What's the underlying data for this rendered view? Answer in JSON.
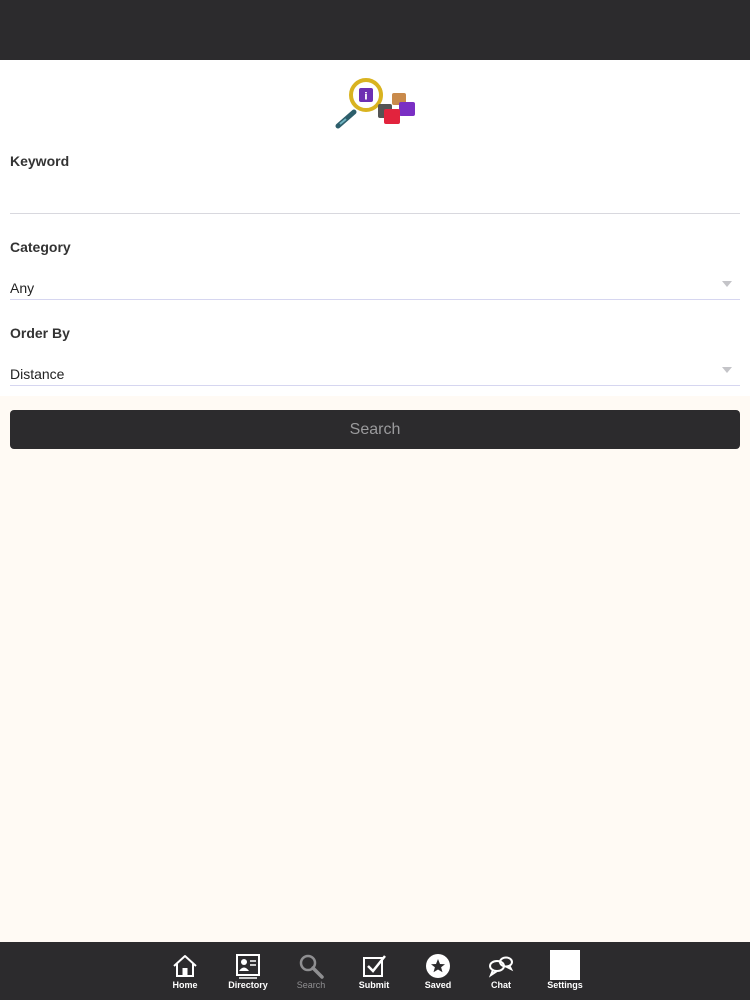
{
  "form": {
    "keyword": {
      "label": "Keyword",
      "value": ""
    },
    "category": {
      "label": "Category",
      "value": "Any"
    },
    "order_by": {
      "label": "Order By",
      "value": "Distance"
    },
    "search_button_label": "Search"
  },
  "tab_bar": {
    "tabs": [
      {
        "label": "Home",
        "icon": "home-icon",
        "active": true
      },
      {
        "label": "Directory",
        "icon": "directory-card-icon",
        "active": true
      },
      {
        "label": "Search",
        "icon": "magnifier-icon",
        "active": false
      },
      {
        "label": "Submit",
        "icon": "checkbox-icon",
        "active": true
      },
      {
        "label": "Saved",
        "icon": "star-circle-icon",
        "active": true
      },
      {
        "label": "Chat",
        "icon": "chat-bubbles-icon",
        "active": true
      },
      {
        "label": "Settings",
        "icon": "settings-square-icon",
        "active": true
      }
    ]
  },
  "colors": {
    "bar_background": "#2c2b2d",
    "page_background": "#fffaf4",
    "form_background": "#ffffff",
    "inactive_tab": "#8f8f91"
  }
}
